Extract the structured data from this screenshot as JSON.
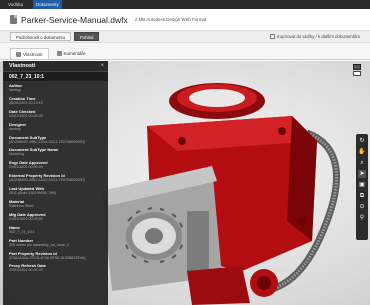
{
  "topnav": {
    "items": [
      "Vodítka",
      "Dokumenty"
    ],
    "active_index": 1
  },
  "header": {
    "title": "Parker-Service-Manual.dwfx",
    "file_info": "2 MB Autodesk Design Web Format"
  },
  "actions": {
    "add_label": "Podrobnosti o dokumentu",
    "view_label": "Pohled",
    "compare_label": "Kopírovat do složky / k dalším dokumentům"
  },
  "tabs": [
    {
      "label": "Vlastnosti",
      "icon": "properties-icon"
    },
    {
      "label": "Komentáře",
      "icon": "comments-icon"
    }
  ],
  "panel": {
    "title": "Vlastnosti",
    "subtitle": "002_7_23_10:1",
    "properties": [
      {
        "label": "Author",
        "value": "lambsy"
      },
      {
        "label": "Creation Time",
        "value": "06/26/2001 10:13:12"
      },
      {
        "label": "Date Checked",
        "value": "01/01/1601 00:00:00"
      },
      {
        "label": "Designer",
        "value": "lambsy"
      },
      {
        "label": "Document SubType",
        "value": "{4D29B490-49B2-11D0-93C3-7E0706000000}"
      },
      {
        "label": "Document SubType Name",
        "value": "Modeling"
      },
      {
        "label": "Engr Date Approved",
        "value": "01/01/1601 00:00:00"
      },
      {
        "label": "External Property Revision Id",
        "value": "{4D29B490-49B2-11D0-93C3-7E0706000000}"
      },
      {
        "label": "Last Updated With",
        "value": "2011 (Build 150299000, 299)"
      },
      {
        "label": "Material",
        "value": "Stainless Steel"
      },
      {
        "label": "Mfg Date Approved",
        "value": "01/01/1601 00:00:00"
      },
      {
        "label": "Name",
        "value": "002_7_23_10:1"
      },
      {
        "label": "Part Number",
        "value": "269 series pto assembly_no_hose_2"
      },
      {
        "label": "Part Property Revision Id",
        "value": "{E3A2A34A-7ECB-4FA8-BF5E-8192B812E4A}"
      },
      {
        "label": "Proxy Refresh Date",
        "value": "01/01/1601 00:00:00"
      }
    ]
  },
  "viewer": {
    "tools": [
      "rotate-icon",
      "pan-icon",
      "zoom-icon",
      "select-icon",
      "section-icon",
      "explode-icon",
      "measure-icon",
      "fit-icon"
    ],
    "active_tool_index": 3,
    "model_colors": {
      "body": "#b30d12",
      "body_dark": "#7a0508",
      "metal": "#9a9a9a",
      "hose": "#6c6c6c"
    }
  }
}
